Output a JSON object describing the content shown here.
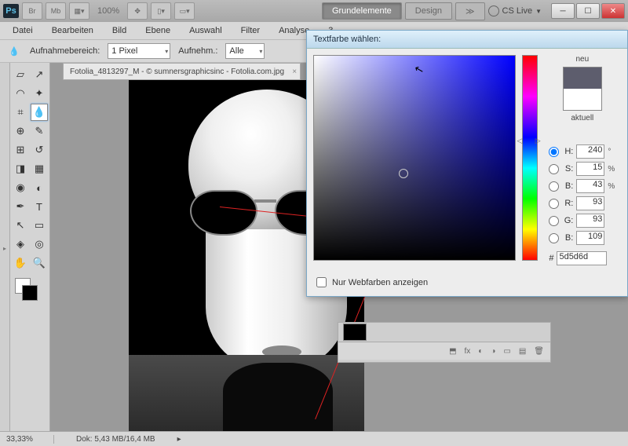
{
  "titlebar": {
    "zoom": "100%",
    "essentials": "Grundelemente",
    "design": "Design",
    "cslive": "CS Live"
  },
  "menu": [
    "Datei",
    "Bearbeiten",
    "Bild",
    "Ebene",
    "Auswahl",
    "Filter",
    "Analyse",
    "3"
  ],
  "options": {
    "range_label": "Aufnahmebereich:",
    "range_value": "1 Pixel",
    "sample_label": "Aufnehm.:",
    "sample_value": "Alle"
  },
  "doc_tab": "Fotolia_4813297_M - © sumnersgraphicsinc - Fotolia.com.jpg",
  "picker": {
    "title": "Textfarbe wählen:",
    "neu": "neu",
    "aktuell": "aktuell",
    "webonly": "Nur Webfarben anzeigen",
    "H": "240",
    "S": "15",
    "B": "43",
    "R": "93",
    "G": "93",
    "Bv": "109",
    "hex": "5d5d6d",
    "deg": "°",
    "pct": "%"
  },
  "layers_foot_icons": [
    "⬒",
    "fx",
    "◐",
    "◑",
    "▭",
    "▤",
    "🗑"
  ],
  "status": {
    "zoom": "33,33%",
    "dok": "Dok: 5,43 MB/16,4 MB"
  }
}
